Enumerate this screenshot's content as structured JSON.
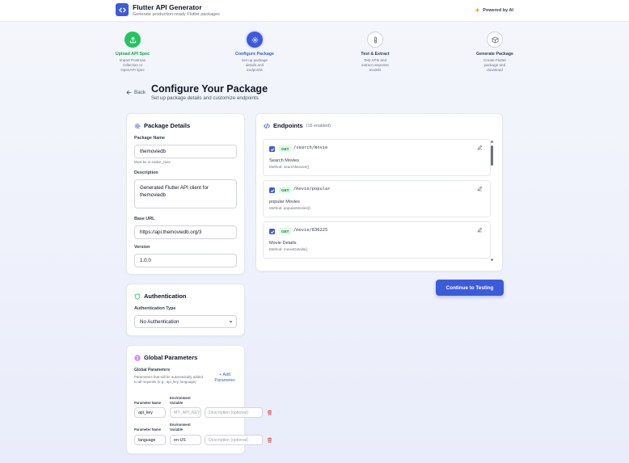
{
  "header": {
    "title": "Flutter API Generator",
    "subtitle": "Generate production-ready Flutter packages",
    "powered": "Powered by AI"
  },
  "steps": [
    {
      "title": "Upload API Spec",
      "desc": "Import Postman collection or OpenAPI spec",
      "state": "done",
      "icon": "upload-icon"
    },
    {
      "title": "Configure Package",
      "desc": "Set up package details and endpoints",
      "state": "active",
      "icon": "gear-icon"
    },
    {
      "title": "Test & Extract",
      "desc": "Test APIs and extract response models",
      "state": "todo",
      "icon": "flask-icon"
    },
    {
      "title": "Generate Package",
      "desc": "Create Flutter package and download",
      "state": "todo",
      "icon": "package-icon"
    }
  ],
  "page": {
    "back": "Back",
    "title": "Configure Your Package",
    "subtitle": "Set up package details and customize endpoints"
  },
  "package_details": {
    "title": "Package Details",
    "name_label": "Package Name",
    "name_value": "themoviedb",
    "name_hint": "Must be in snake_case",
    "desc_label": "Description",
    "desc_line1": "Generated Flutter API client for",
    "desc_line2": "themoviedb",
    "base_url_label": "Base URL",
    "base_url_value": "https://api.themoviedb.org/3",
    "version_label": "Version",
    "version_value": "1.0.0"
  },
  "authentication": {
    "title": "Authentication",
    "type_label": "Authentication Type",
    "type_value": "No Authentication"
  },
  "global_params": {
    "title": "Global Parameters",
    "subtitle": "Global Parameters",
    "hint": "Parameters that will be automatically added to all requests (e.g., api_key, language)",
    "add_label_1": "+ Add",
    "add_label_2": "Parameter",
    "col_name": "Parameter Name",
    "col_env_1": "Environment",
    "col_env_2": "Variable",
    "rows": [
      {
        "name": "api_key",
        "env": "MY_API_KEY",
        "desc_placeholder": "Description (optional)"
      },
      {
        "name": "language",
        "env": "en-US",
        "desc_placeholder": "Description (optional)"
      }
    ]
  },
  "endpoints": {
    "title": "Endpoints",
    "count": "(16 enabled)",
    "items": [
      {
        "method": "GET",
        "path": "/search/movie",
        "name": "Search Movies",
        "method_name": "Method: searchMovies()"
      },
      {
        "method": "GET",
        "path": "/movie/popular",
        "name": "popular Movies",
        "method_name": "Method: popularMovies()"
      },
      {
        "method": "GET",
        "path": "/movie/836225",
        "name": "Movie Details",
        "method_name": "Method: movieDetails()"
      }
    ]
  },
  "actions": {
    "continue": "Continue to Testing"
  },
  "colors": {
    "primary": "#3b5bdb",
    "success": "#22c55e",
    "danger": "#ef4444"
  }
}
